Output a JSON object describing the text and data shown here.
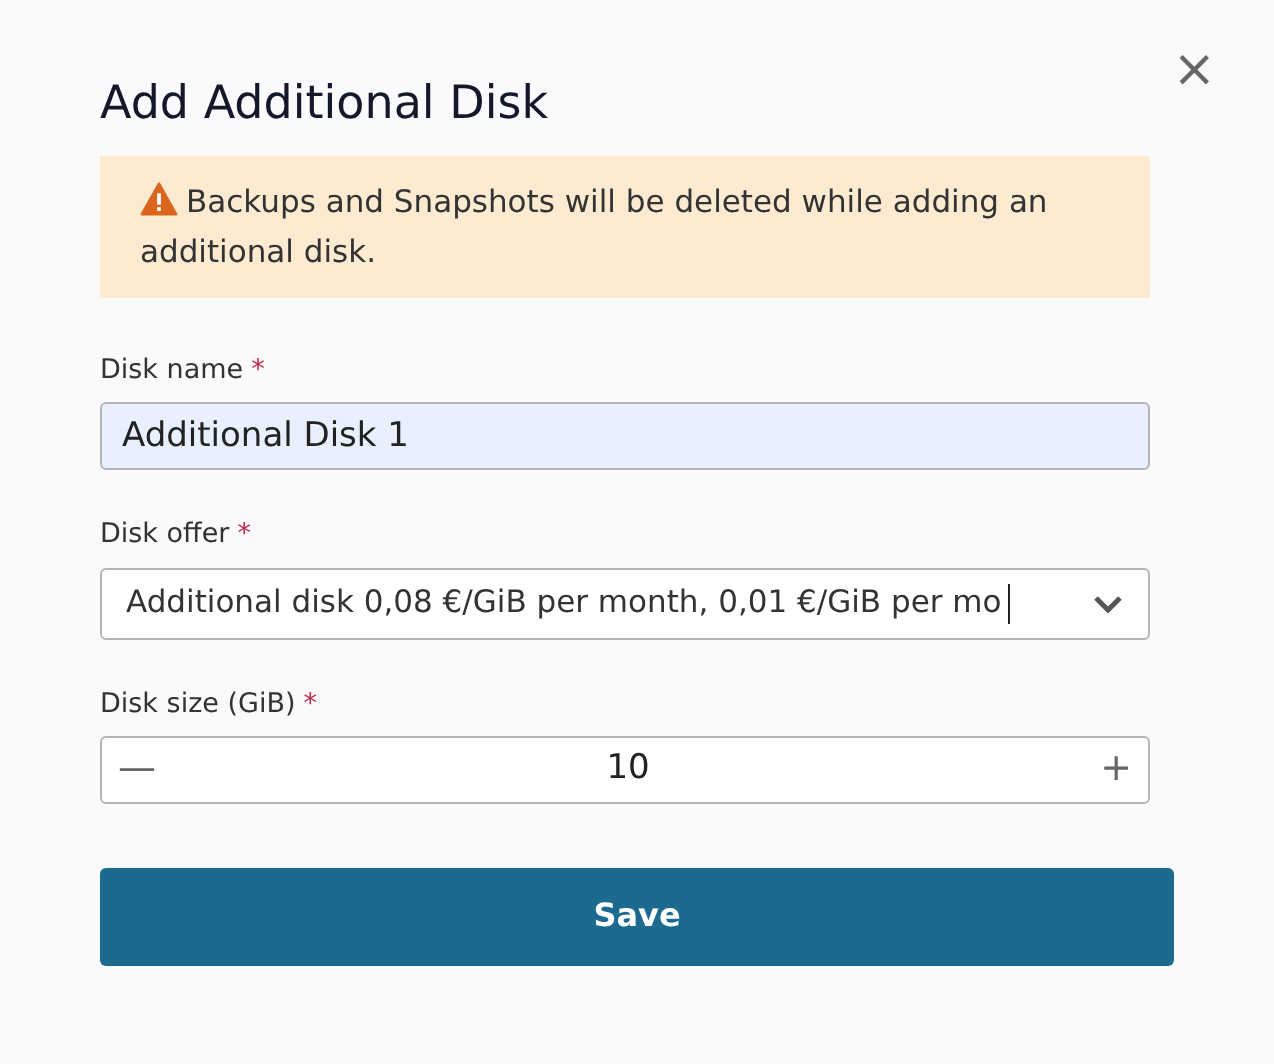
{
  "dialog": {
    "title": "Add Additional Disk",
    "close": "×"
  },
  "alert": {
    "kind": "warning",
    "text": "Backups and Snapshots will be deleted while adding an additional disk."
  },
  "fields": [
    {
      "kind": "text",
      "label": "Disk name",
      "required": "*",
      "value": "Additional Disk 1",
      "autofilled": true
    },
    {
      "kind": "select",
      "label": "Disk offer",
      "required": "*",
      "value": "Additional disk 0,08 €/GiB per month, 0,01 €/GiB per mo",
      "focused": true
    },
    {
      "kind": "stepper",
      "label": "Disk size (GiB)",
      "required": "*",
      "value": "10",
      "minus": "—",
      "plus": "+"
    }
  ],
  "buttons": [
    {
      "label": "Save",
      "kind": "primary"
    }
  ]
}
